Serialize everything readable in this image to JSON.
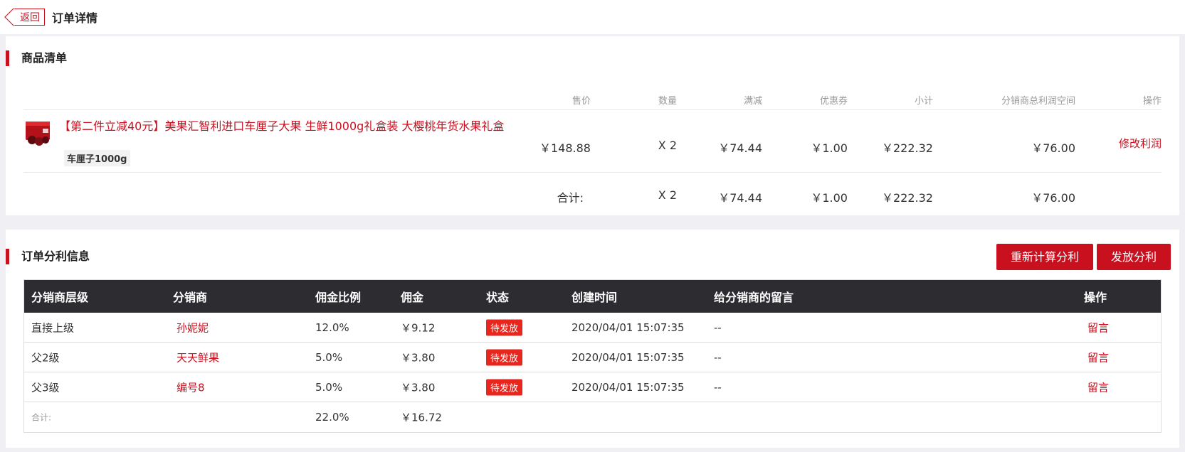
{
  "header": {
    "back_label": "返回",
    "title": "订单详情"
  },
  "goods": {
    "section_title": "商品清单",
    "columns": {
      "price": "售价",
      "qty": "数量",
      "discount": "满减",
      "coupon": "优惠券",
      "subtotal": "小计",
      "profit": "分销商总利润空间",
      "action": "操作"
    },
    "items": [
      {
        "title": "【第二件立减40元】美果汇智利进口车厘子大果 生鲜1000g礼盒装 大樱桃年货水果礼盒",
        "sku": "车厘子1000g",
        "price": "￥148.88",
        "qty": "X 2",
        "discount": "￥74.44",
        "coupon": "￥1.00",
        "subtotal": "￥222.32",
        "profit": "￥76.00",
        "action": "修改利润"
      }
    ],
    "summary": {
      "label": "合计:",
      "qty": "X 2",
      "discount": "￥74.44",
      "coupon": "￥1.00",
      "subtotal": "￥222.32",
      "profit": "￥76.00"
    }
  },
  "distribution": {
    "section_title": "订单分利信息",
    "recalc_button": "重新计算分利",
    "issue_button": "发放分利",
    "columns": {
      "level": "分销商层级",
      "distributor": "分销商",
      "ratio": "佣金比例",
      "commission": "佣金",
      "status": "状态",
      "created": "创建时间",
      "message": "给分销商的留言",
      "action": "操作"
    },
    "rows": [
      {
        "level": "直接上级",
        "distributor": "孙妮妮",
        "ratio": "12.0%",
        "commission": "￥9.12",
        "status": "待发放",
        "created": "2020/04/01 15:07:35",
        "message": "--",
        "action": "留言"
      },
      {
        "level": "父2级",
        "distributor": "天天鲜果",
        "ratio": "5.0%",
        "commission": "￥3.80",
        "status": "待发放",
        "created": "2020/04/01 15:07:35",
        "message": "--",
        "action": "留言"
      },
      {
        "level": "父3级",
        "distributor": "编号8",
        "ratio": "5.0%",
        "commission": "￥3.80",
        "status": "待发放",
        "created": "2020/04/01 15:07:35",
        "message": "--",
        "action": "留言"
      }
    ],
    "summary": {
      "label": "合计:",
      "ratio": "22.0%",
      "commission": "￥16.72"
    }
  },
  "colors": {
    "accent": "#c8101f",
    "badge": "#e8261d",
    "table_header": "#2d2c30",
    "background": "#efeff4"
  },
  "icons": {
    "back": "chevron-left-icon",
    "product": "cherry-gift-box-image"
  }
}
